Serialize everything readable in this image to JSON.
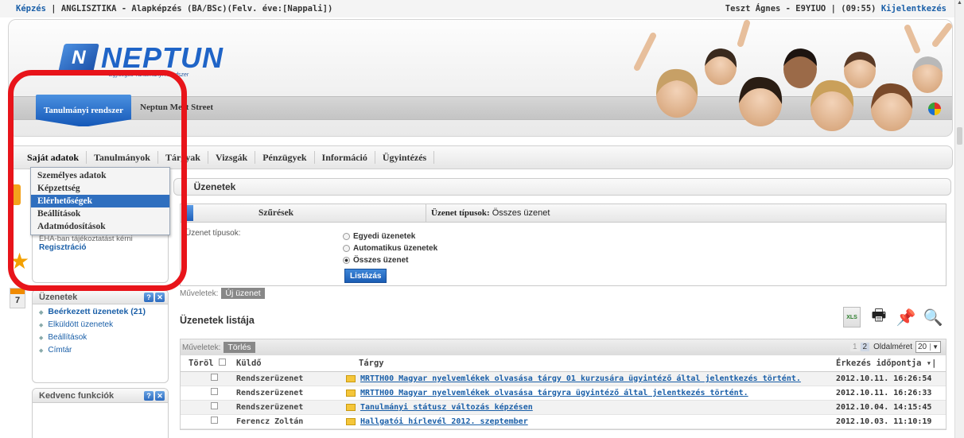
{
  "topbar": {
    "left_link": "Képzés",
    "left_text": " | ANGLISZTIKA - Alapképzés (BA/BSc)(Felv. éve:[Nappali])",
    "user": "Teszt Ágnes - E9YIUO",
    "timer": "(09:55)",
    "logout": "Kijelentkezés"
  },
  "header": {
    "logo_name": "NEPTUN",
    "logo_mark": "N",
    "logo_sub": "Egységes Tanulmányi Rendszer",
    "tab_active": "Tanulmányi rendszer",
    "tab_other": "Neptun Meet Street"
  },
  "menubar": [
    "Saját adatok",
    "Tanulmányok",
    "Tárgyak",
    "Vizsgák",
    "Pénzügyek",
    "Információ",
    "Ügyintézés"
  ],
  "dropdown": {
    "items": [
      "Személyes adatok",
      "Képzettség",
      "Elérhetőségek",
      "Beállítások",
      "Adatmódosítások"
    ],
    "selected_index": 2
  },
  "sidebar": {
    "reg_small": "EHA-ban tájékoztatást kérni",
    "reg_link": "Regisztráció",
    "calendar_day": "7",
    "messages_panel": {
      "title": "Üzenetek",
      "links": [
        "Beérkezett üzenetek (21)",
        "Elküldött üzenetek",
        "Beállítások",
        "Címtár"
      ]
    },
    "favorites_panel": {
      "title": "Kedvenc funkciók"
    }
  },
  "main": {
    "title": "Üzenetek",
    "filter": {
      "label": "Szűrések",
      "type_label": "Üzenet típusok:",
      "type_value": "Összes üzenet",
      "field_label": "Üzenet típusok:",
      "options": [
        "Egyedi üzenetek",
        "Automatikus üzenetek",
        "Összes üzenet"
      ],
      "selected_index": 2,
      "button": "Listázás"
    },
    "ops_label": "Műveletek:",
    "new_message": "Új üzenet",
    "list_title": "Üzenetek listája",
    "delete": "Törlés",
    "pages": [
      "1",
      "2"
    ],
    "current_page": "2",
    "page_size_label": "Oldalméret",
    "page_size": "20",
    "columns": {
      "torol": "Töröl",
      "sender": "Küldő",
      "subject": "Tárgy",
      "date": "Érkezés időpontja"
    },
    "rows": [
      {
        "sender": "Rendszerüzenet",
        "subject": "MRTTH00 Magyar nyelvemlékek olvasása tárgy 01 kurzusára ügyintéző által jelentkezés történt.",
        "date": "2012.10.11. 16:26:54"
      },
      {
        "sender": "Rendszerüzenet",
        "subject": "MRTTH00 Magyar nyelvemlékek olvasása tárgyra ügyintéző által jelentkezés történt.",
        "date": "2012.10.11. 16:26:33"
      },
      {
        "sender": "Rendszerüzenet",
        "subject": "Tanulmányi státusz változás képzésen",
        "date": "2012.10.04. 14:15:45"
      },
      {
        "sender": "Ferencz Zoltán",
        "subject": "Hallgatói hírlevél 2012. szeptember",
        "date": "2012.10.03. 11:10:19"
      }
    ]
  },
  "colors": {
    "accent_blue": "#1f64c7",
    "link_blue": "#1a5fa8",
    "annotation_red": "#e8141a",
    "selection_blue": "#2f6fbf"
  }
}
